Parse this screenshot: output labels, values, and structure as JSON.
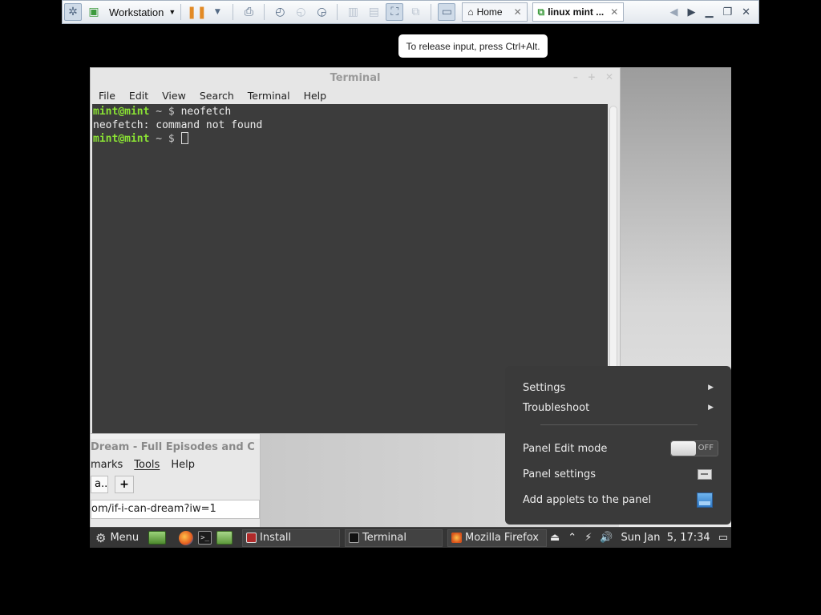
{
  "vm_toolbar": {
    "workstation_label": "Workstation",
    "tabs": [
      {
        "label": "Home"
      },
      {
        "label": "linux mint ..."
      }
    ]
  },
  "tooltip": "To release input, press Ctrl+Alt.",
  "terminal": {
    "title": "Terminal",
    "menu": [
      "File",
      "Edit",
      "View",
      "Search",
      "Terminal",
      "Help"
    ],
    "lines": [
      {
        "prompt": "mint@mint",
        "rest": " ~ $ ",
        "text": "neofetch"
      },
      {
        "output": "neofetch: command not found"
      },
      {
        "prompt": "mint@mint",
        "rest": " ~ $ ",
        "text": ""
      }
    ]
  },
  "firefox_window": {
    "title_fragment": "Dream - Full Episodes and C",
    "menu": [
      "marks",
      "Tools",
      "Help"
    ],
    "tab_fragment": "a...",
    "new_tab": "+",
    "url_fragment": "om/if-i-can-dream?iw=1"
  },
  "context_menu": {
    "settings": "Settings",
    "troubleshoot": "Troubleshoot",
    "panel_edit_mode": "Panel Edit mode",
    "toggle_state": "OFF",
    "panel_settings": "Panel settings",
    "add_applets": "Add applets to the panel"
  },
  "panel": {
    "menu_label": "Menu",
    "tasks": [
      {
        "label": "Install"
      },
      {
        "label": "Terminal"
      },
      {
        "label": "Mozilla Firefox"
      }
    ],
    "clock": "Sun Jan  5, 17:34"
  },
  "colors": {
    "prompt_green": "#8ae234",
    "terminal_bg": "#3c3c3c",
    "panel_bg": "#353535",
    "menu_bg": "#3a3a3a"
  }
}
